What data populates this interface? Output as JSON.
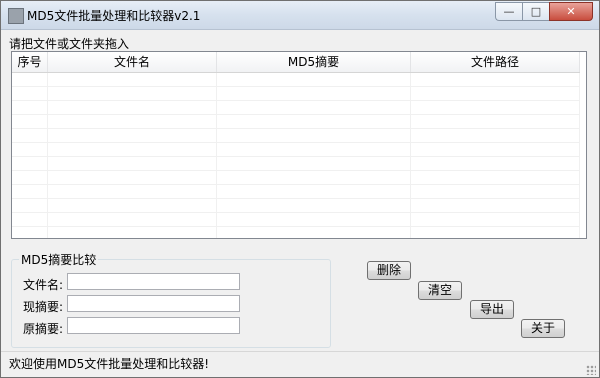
{
  "window": {
    "title": "MD5文件批量处理和比较器v2.1",
    "controls": {
      "minimize": "—",
      "maximize": "□",
      "close": "✕"
    }
  },
  "drop_area": {
    "label": "请把文件或文件夹拖入",
    "columns": [
      "序号",
      "文件名",
      "MD5摘要",
      "文件路径"
    ]
  },
  "compare": {
    "group_title": "MD5摘要比较",
    "fields": [
      {
        "label": "文件名:",
        "value": ""
      },
      {
        "label": "现摘要:",
        "value": ""
      },
      {
        "label": "原摘要:",
        "value": ""
      }
    ]
  },
  "buttons": {
    "delete": "删除",
    "clear": "清空",
    "export": "导出",
    "about": "关于"
  },
  "status": {
    "text": "欢迎使用MD5文件批量处理和比较器!"
  },
  "icons": {
    "app": "app-icon",
    "grip": "resize-grip-icon"
  }
}
